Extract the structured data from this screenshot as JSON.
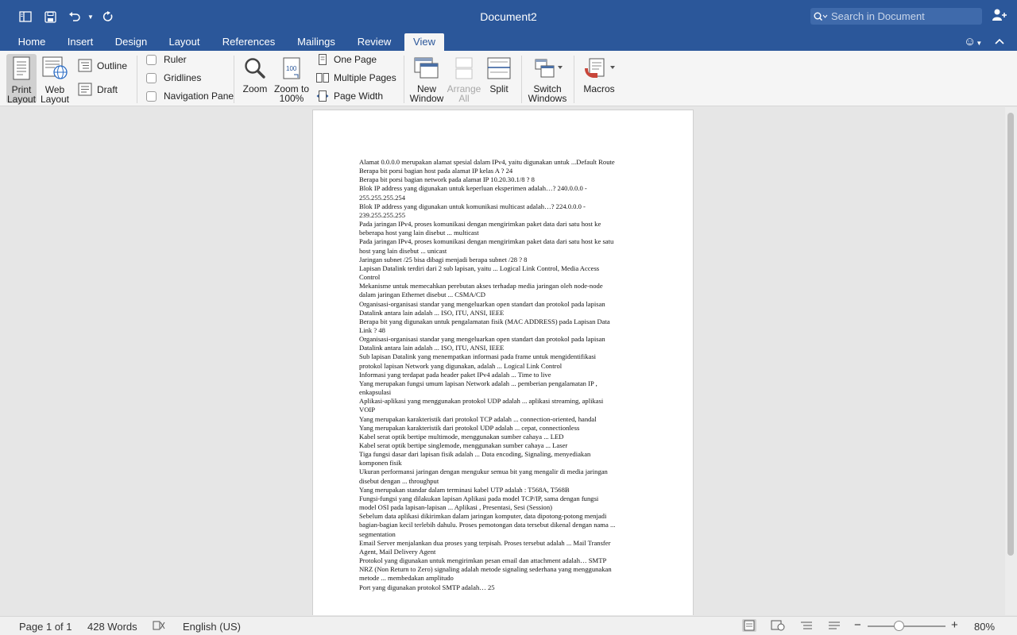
{
  "window": {
    "title": "Document2"
  },
  "search": {
    "placeholder": "Search in Document"
  },
  "tabs": [
    {
      "label": "Home"
    },
    {
      "label": "Insert"
    },
    {
      "label": "Design"
    },
    {
      "label": "Layout"
    },
    {
      "label": "References"
    },
    {
      "label": "Mailings"
    },
    {
      "label": "Review"
    },
    {
      "label": "View"
    }
  ],
  "ribbon": {
    "print_layout": [
      "Print",
      "Layout"
    ],
    "web_layout": [
      "Web",
      "Layout"
    ],
    "outline": "Outline",
    "draft": "Draft",
    "ruler": "Ruler",
    "gridlines": "Gridlines",
    "navigation_pane": "Navigation Pane",
    "zoom": "Zoom",
    "zoom_100": [
      "Zoom to",
      "100%"
    ],
    "one_page": "One Page",
    "multiple_pages": "Multiple Pages",
    "page_width": "Page Width",
    "new_window": [
      "New",
      "Window"
    ],
    "arrange_all": [
      "Arrange",
      "All"
    ],
    "split": "Split",
    "switch_windows": [
      "Switch",
      "Windows"
    ],
    "macros": "Macros"
  },
  "document": {
    "lines": [
      "Alamat 0.0.0.0 merupakan alamat spesial dalam IPv4, yaitu digunakan untuk ...Default Route",
      "Berapa bit porsi bagian host pada alamat IP kelas A ? 24",
      "Berapa bit porsi bagian network pada alamat IP 10.20.30.1/8 ? 8",
      "Blok IP address yang digunakan untuk keperluan eksperimen adalah…? 240.0.0.0 -",
      "255.255.255.254",
      "Blok IP address yang digunakan untuk komunikasi multicast adalah…? 224.0.0.0 -",
      "239.255.255.255",
      "Pada jaringan IPv4, proses komunikasi dengan mengirimkan paket data dari satu host ke",
      "beberapa host yang lain disebut ... multicast",
      "Pada jaringan IPv4, proses komunikasi dengan mengirimkan paket data dari satu host ke satu",
      "host yang lain disebut ... unicast",
      "Jaringan subnet /25 bisa dibagi menjadi berapa subnet /28 ? 8",
      "Lapisan Datalink terdiri dari 2 sub lapisan, yaitu ... Logical Link Control, Media Access",
      "Control",
      "Mekanisme untuk memecahkan perebutan akses terhadap media jaringan oleh node-node",
      "dalam jaringan Ethernet disebut ... CSMA/CD",
      "Organisasi-organisasi standar yang mengeluarkan open standart dan protokol pada lapisan",
      "Datalink antara lain adalah ... ISO, ITU, ANSI, IEEE",
      "Berapa bit yang digunakan untuk pengalamatan fisik (MAC ADDRESS) pada Lapisan Data",
      "Link ? 48",
      "Organisasi-organisasi standar yang mengeluarkan open standart dan protokol pada lapisan",
      "Datalink antara lain adalah ... ISO, ITU, ANSI, IEEE",
      "Sub lapisan Datalink yang menempatkan informasi pada frame untuk mengidentifikasi",
      "protokol lapisan Network yang digunakan, adalah ... Logical Link Control",
      "Informasi yang terdapat pada header paket IPv4 adalah ... Time to live",
      "Yang merupakan fungsi umum lapisan Network adalah ... pemberian pengalamatan IP ,",
      "enkapsulasi",
      "Aplikasi-aplikasi yang menggunakan protokol UDP adalah ... aplikasi streaming, aplikasi",
      "VOIP",
      "Yang merupakan karakteristik dari protokol TCP adalah ... connection-oriented, handal",
      "Yang merupakan karakteristik dari protokol UDP adalah ... cepat, connectionless",
      "Kabel serat optik bertipe multimode, menggunakan sumber cahaya ... LED",
      "Kabel serat optik bertipe singlemode, menggunakan sumber cahaya ...  Laser",
      "Tiga fungsi dasar dari lapisan fisik adalah ... Data encoding, Signaling, menyediakan",
      "komponen fisik",
      "Ukuran performansi jaringan dengan mengukur semua bit yang mengalir di media jaringan",
      "disebut dengan ... throughput",
      "Yang merupakan standar dalam terminasi kabel UTP adalah : T568A, T568B",
      "Fungsi-fungsi yang dilakukan lapisan Aplikasi pada model TCP/IP, sama dengan fungsi",
      "model OSI pada lapisan-lapisan ... Aplikasi , Presentasi, Sesi (Session)",
      "Sebelum data aplikasi dikirimkan dalam jaringan komputer, data dipotong-potong menjadi",
      "bagian-bagian kecil terlebih dahulu. Proses pemotongan data tersebut dikenal dengan nama ...",
      "segmentation",
      "Email Server menjalankan dua proses yang terpisah. Proses tersebut adalah ... Mail Transfer",
      "Agent, Mail Delivery Agent",
      "Protokol yang digunakan untuk mengirimkan pesan email dan attachment adalah… SMTP",
      "NRZ (Non Return to Zero) signaling adalah metode signaling sederhana yang menggunakan",
      "metode ... membedakan amplitudo",
      "Port yang digunakan protokol SMTP adalah…  25"
    ]
  },
  "status": {
    "page": "Page 1 of 1",
    "words": "428 Words",
    "language": "English (US)",
    "zoom": "80%"
  }
}
